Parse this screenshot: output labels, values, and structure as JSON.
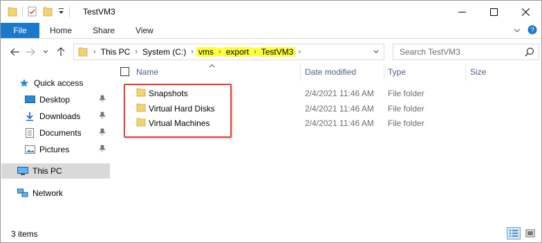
{
  "window": {
    "title": "TestVM3",
    "controls": {
      "minimize": "minimize",
      "maximize": "maximize",
      "close": "close"
    }
  },
  "ribbon": {
    "tabs": [
      "File",
      "Home",
      "Share",
      "View"
    ]
  },
  "address": {
    "crumbs": [
      {
        "label": "This PC",
        "highlighted": false
      },
      {
        "label": "System (C:)",
        "highlighted": false
      },
      {
        "label": "vms",
        "highlighted": true
      },
      {
        "label": "export",
        "highlighted": true
      },
      {
        "label": "TestVM3",
        "highlighted": true
      }
    ],
    "highlight_color": "#ffff3c"
  },
  "search": {
    "placeholder": "Search TestVM3"
  },
  "sidebar": {
    "items": [
      {
        "label": "Quick access",
        "icon": "star-icon",
        "pinned": false
      },
      {
        "label": "Desktop",
        "icon": "desktop-icon",
        "pinned": true
      },
      {
        "label": "Downloads",
        "icon": "download-icon",
        "pinned": true
      },
      {
        "label": "Documents",
        "icon": "document-icon",
        "pinned": true
      },
      {
        "label": "Pictures",
        "icon": "pictures-icon",
        "pinned": true
      },
      {
        "label": "This PC",
        "icon": "computer-icon",
        "pinned": false,
        "selected": true
      },
      {
        "label": "Network",
        "icon": "network-icon",
        "pinned": false
      }
    ]
  },
  "columns": {
    "name": "Name",
    "date": "Date modified",
    "type": "Type",
    "size": "Size"
  },
  "files": [
    {
      "name": "Snapshots",
      "date": "2/4/2021 11:46 AM",
      "type": "File folder"
    },
    {
      "name": "Virtual Hard Disks",
      "date": "2/4/2021 11:46 AM",
      "type": "File folder"
    },
    {
      "name": "Virtual Machines",
      "date": "2/4/2021 11:46 AM",
      "type": "File folder"
    }
  ],
  "status": {
    "count": "3 items"
  },
  "colors": {
    "accent": "#1979ca",
    "annotation": "#e3403a"
  }
}
